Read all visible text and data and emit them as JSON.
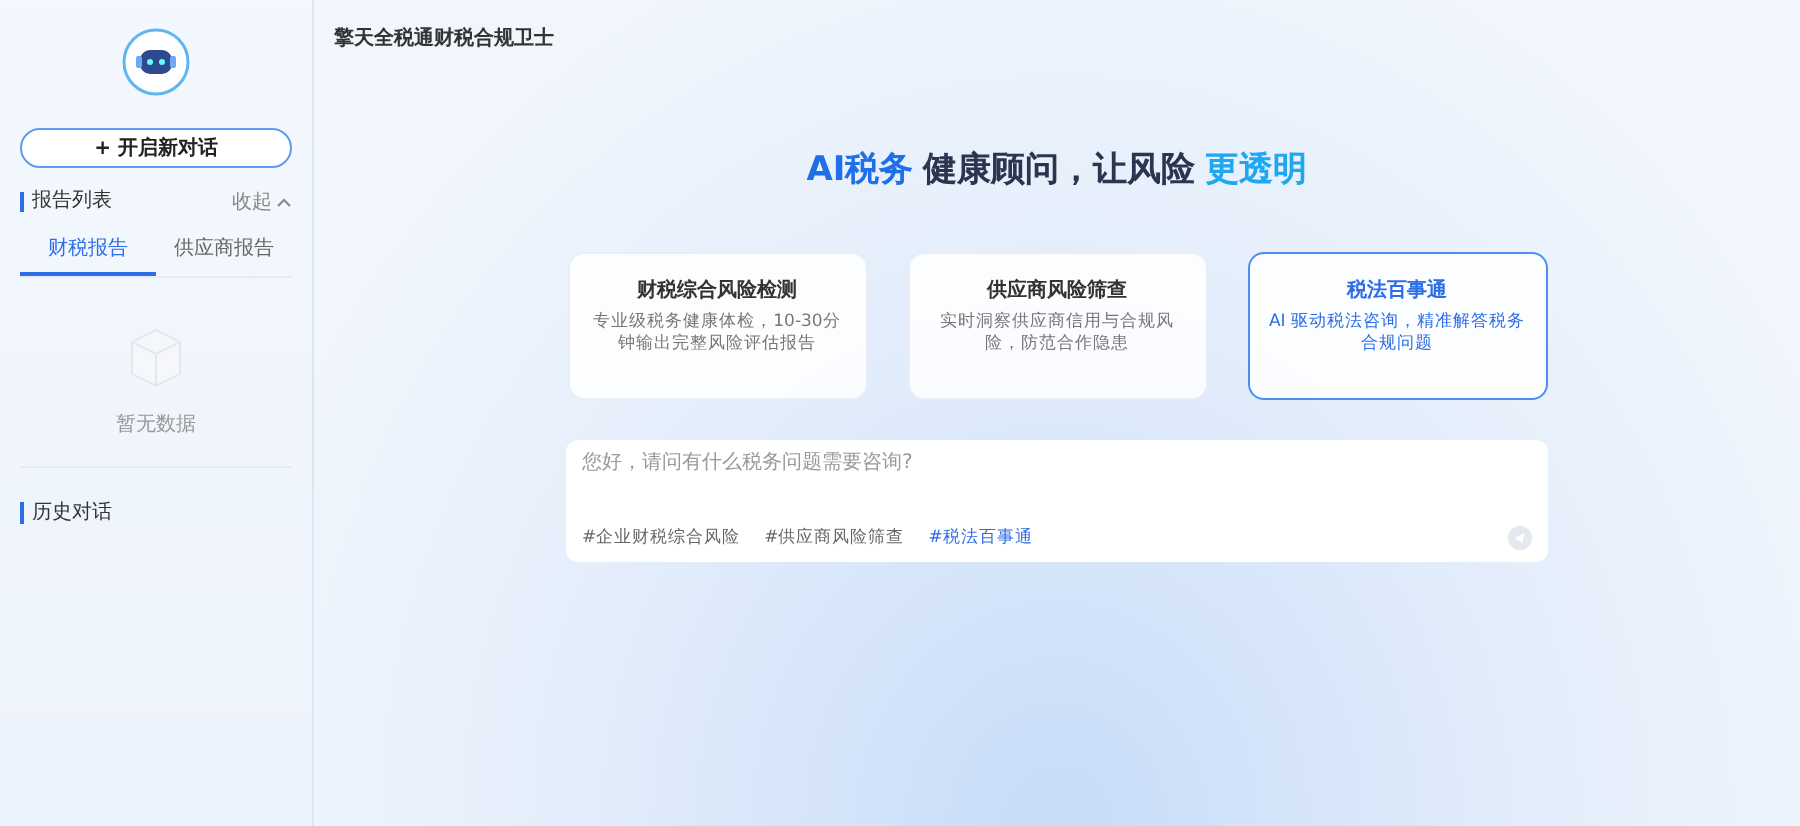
{
  "sidebar": {
    "new_chat_button": "+ 开启新对话",
    "report_list": {
      "title": "报告列表",
      "collapse": "收起",
      "expanded": true,
      "tabs": [
        {
          "label": "财税报告",
          "selected": true
        },
        {
          "label": "供应商报告",
          "selected": false
        }
      ],
      "empty_text": "暂无数据"
    },
    "history": {
      "title": "历史对话"
    }
  },
  "header": {
    "title": "擎天全税通财税合规卫士"
  },
  "headline": [
    {
      "text": "AI税务",
      "color": "#1f6fe8"
    },
    {
      "text": "健康顾问，让风险",
      "color": "#2a3550"
    },
    {
      "text": "更透明",
      "color": "#1fa8f0"
    }
  ],
  "cards": [
    {
      "title": "财税综合风险检测",
      "description": "专业级税务健康体检，10-30分钟输出完整风险评估报告",
      "selected": false
    },
    {
      "title": "供应商风险筛查",
      "description": "实时洞察供应商信用与合规风险，防范合作隐患",
      "selected": false
    },
    {
      "title": "税法百事通",
      "description": "AI 驱动税法咨询，精准解答税务合规问题",
      "selected": true
    }
  ],
  "chat_input": {
    "placeholder": "您好，请问有什么税务问题需要咨询?",
    "tags": [
      {
        "label": "#企业财税综合风险",
        "selected": false
      },
      {
        "label": "#供应商风险筛查",
        "selected": false
      },
      {
        "label": "#税法百事通",
        "selected": true
      }
    ]
  }
}
